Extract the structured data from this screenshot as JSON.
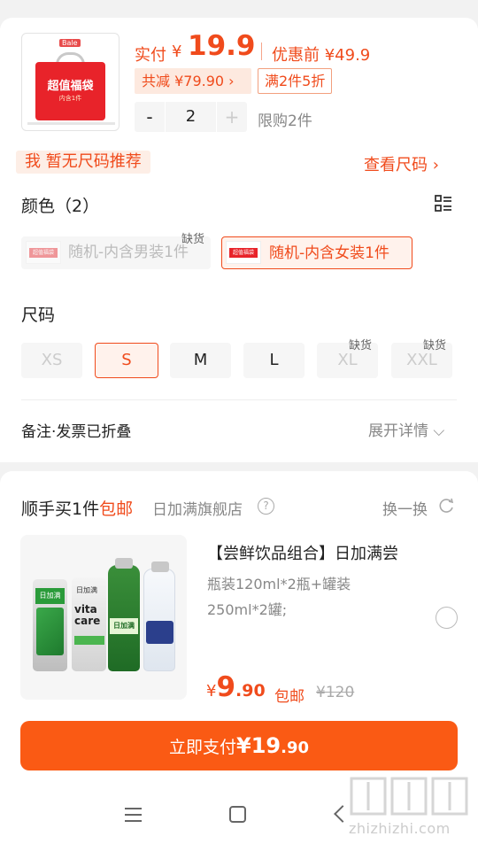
{
  "product": {
    "thumb_brand": "Bale",
    "thumb_title": "超值福袋",
    "thumb_sub": "内含1件",
    "price_label": "实付",
    "currency": "¥",
    "price": "19.9",
    "original_label": "优惠前 ¥49.9",
    "discount": "共减 ¥79.90 ›",
    "promo": "满2件5折",
    "quantity": "2",
    "minus": "-",
    "plus": "+",
    "limit": "限购2件"
  },
  "size_hint": {
    "text": "我 暂无尺码推荐",
    "link": "查看尺码 ›"
  },
  "color": {
    "title": "颜色（2）",
    "options": [
      {
        "label": "随机-内含男装1件",
        "badge": "缺货",
        "state": "disabled"
      },
      {
        "label": "随机-内含女装1件",
        "badge": "",
        "state": "selected"
      }
    ],
    "mini_label": "超值福袋"
  },
  "size": {
    "title": "尺码",
    "options": [
      {
        "label": "XS",
        "badge": "",
        "state": "disabled"
      },
      {
        "label": "S",
        "badge": "",
        "state": "selected"
      },
      {
        "label": "M",
        "badge": "",
        "state": "normal"
      },
      {
        "label": "L",
        "badge": "",
        "state": "normal"
      },
      {
        "label": "XL",
        "badge": "缺货",
        "state": "disabled"
      },
      {
        "label": "XXL",
        "badge": "缺货",
        "state": "disabled"
      }
    ]
  },
  "remark": {
    "label": "备注·发票已折叠",
    "expand": "展开详情 ⌵"
  },
  "addon": {
    "title_prefix": "顺手买1件",
    "title_free": "包邮",
    "store": "日加满旗舰店",
    "help": "?",
    "swap": "换一换",
    "name": "【尝鲜饮品组合】日加满尝",
    "spec_line1": "瓶装120ml*2瓶+罐装",
    "spec_line2": "250ml*2罐;",
    "currency": "¥",
    "price_int": "9",
    "price_dec": ".90",
    "free_ship": "包邮",
    "orig_price": "¥120",
    "can_text": "日加满",
    "can2_text": "vita care"
  },
  "pay": {
    "label": "立即支付",
    "currency": "¥",
    "amount_int": "19",
    "amount_dec": ".90"
  },
  "watermark": {
    "text": "zhizhizhi.com",
    "glyph": "值值值"
  },
  "colors": {
    "accent": "#f04b1c",
    "pay_button": "#fa5a14",
    "selected_bg": "#fff2ec",
    "option_bg": "#f6f6f6"
  },
  "icons": [
    "list-icon",
    "help-icon",
    "refresh-icon",
    "menu-icon",
    "home-icon",
    "back-icon"
  ]
}
